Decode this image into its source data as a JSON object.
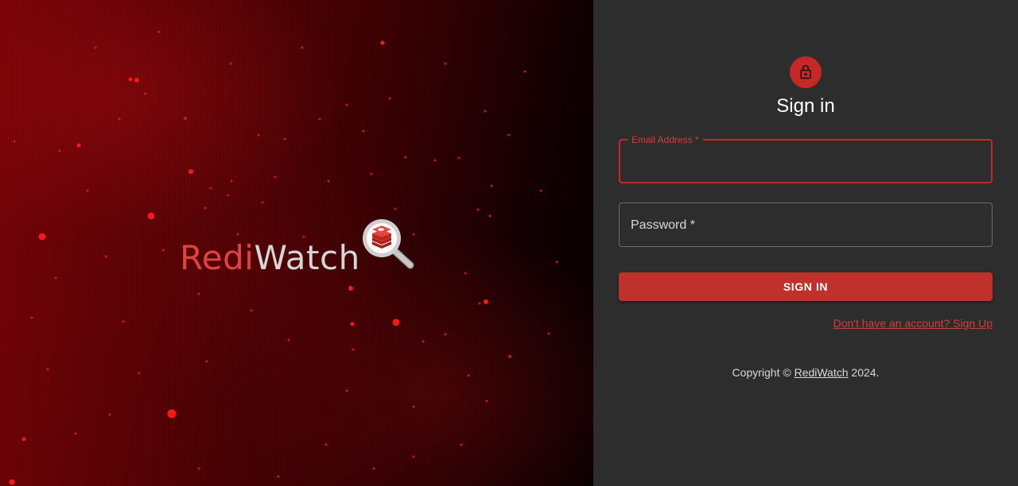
{
  "hero": {
    "logo": {
      "part1": "Redi",
      "part2": "Watch"
    },
    "colors": {
      "background": "#5a0206",
      "particles": "#ff1a1a",
      "logo_red": "#e0433f",
      "logo_grey": "#d6d6d6"
    }
  },
  "form": {
    "title": "Sign in",
    "email": {
      "label": "Email Address *",
      "value": ""
    },
    "password": {
      "label": "Password *",
      "value": ""
    },
    "submit_label": "SIGN IN",
    "signup_link": "Don't have an account? Sign Up",
    "icon": "lock-icon"
  },
  "footer": {
    "prefix": "Copyright © ",
    "brand": "RediWatch",
    "suffix": " 2024."
  },
  "colors": {
    "panel_bg": "#2d2d2d",
    "accent": "#c62828",
    "button": "#c0312b",
    "link": "#d0403b"
  }
}
